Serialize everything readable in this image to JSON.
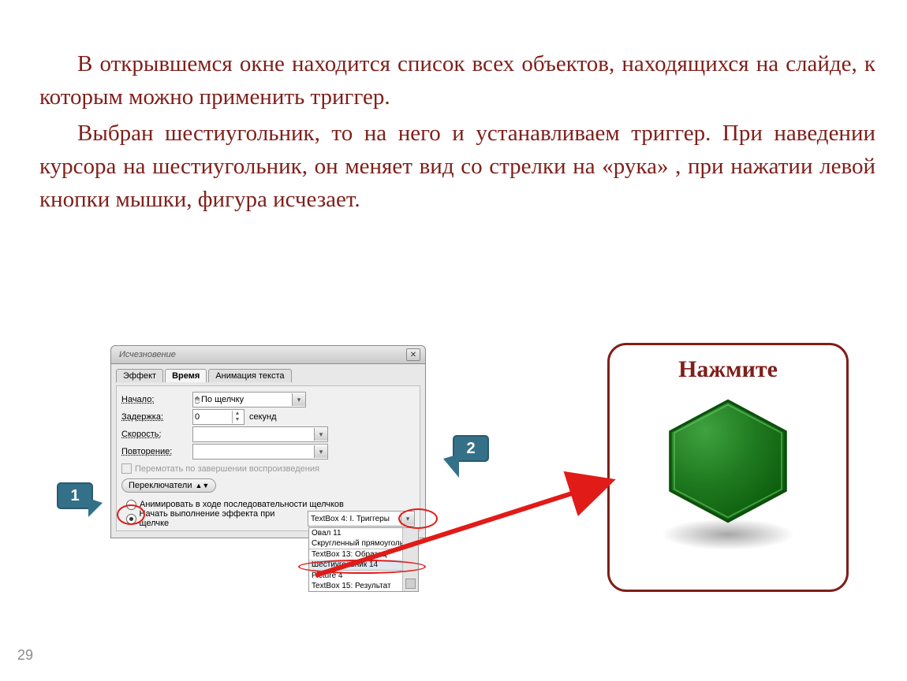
{
  "text": {
    "p1": "В открывшемся окне находится список всех объектов, находящихся на слайде, к которым можно применить триггер.",
    "p2": "Выбран шестиугольник, то на него и устанавливаем триггер. При наведении курсора на шестиугольник, он меняет вид со стрелки на «рука» , при нажатии левой кнопки мышки, фигура исчезает."
  },
  "page_number": "29",
  "click_panel": {
    "title": "Нажмите"
  },
  "dialog": {
    "title": "Исчезновение",
    "tabs": [
      "Эффект",
      "Время",
      "Анимация текста"
    ],
    "active_tab": 1,
    "labels": {
      "start": "Начало:",
      "delay": "Задержка:",
      "speed": "Скорость:",
      "repeat": "Повторение:",
      "delay_unit": "секунд",
      "rewind": "Перемотать по завершении воспроизведения",
      "switches": "Переключатели",
      "radio1": "Анимировать в ходе последовательности щелчков",
      "radio2": "Начать выполнение эффекта при щелчке"
    },
    "values": {
      "start": "По щелчку",
      "delay": "0",
      "select": "TextBox 4: I. Триггеры"
    },
    "dropdown_items": [
      "Овал 11",
      "Скругленный прямоуголь",
      "TextBox 13: Образец",
      "Шестиугольник 14",
      "Picture 4",
      "TextBox 15: Результат"
    ],
    "highlight_index": 3
  },
  "callouts": {
    "c1": "1",
    "c2": "2"
  }
}
